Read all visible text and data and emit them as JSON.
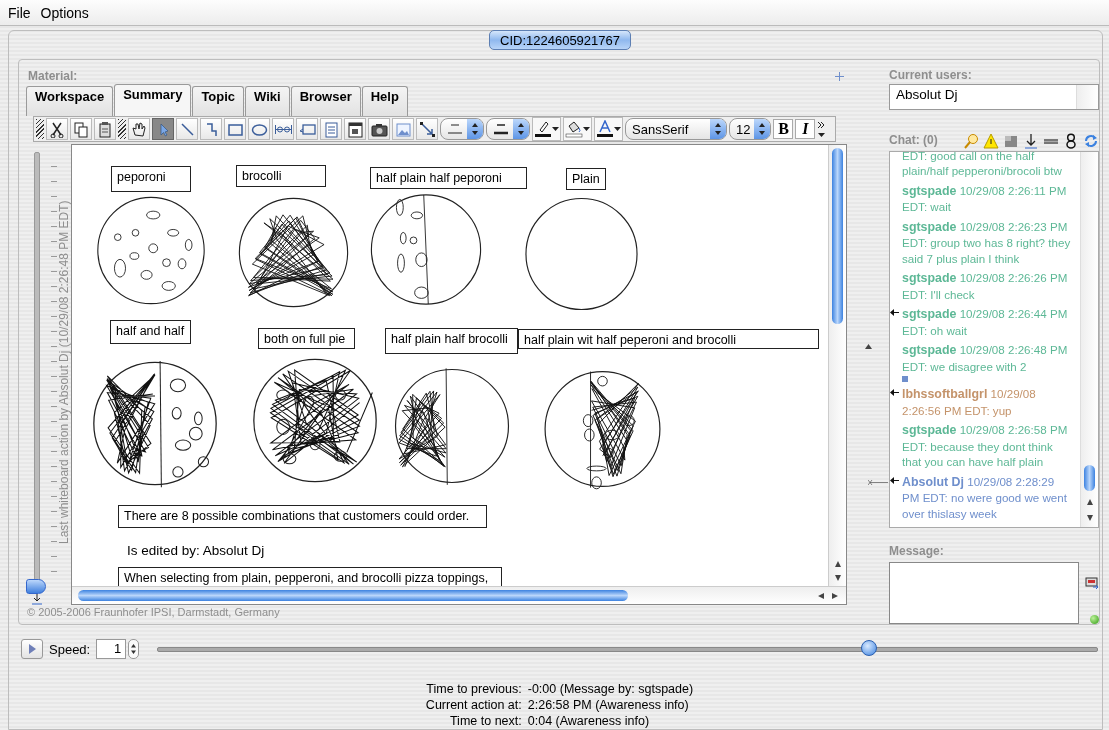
{
  "menu": [
    "File",
    "Options"
  ],
  "cid": "CID:1224605921767",
  "material_label": "Material:",
  "tabs": [
    {
      "label": "Workspace",
      "selected": false
    },
    {
      "label": "Summary",
      "selected": true
    },
    {
      "label": "Topic",
      "selected": false
    },
    {
      "label": "Wiki",
      "selected": false
    },
    {
      "label": "Browser",
      "selected": false
    },
    {
      "label": "Help",
      "selected": false
    }
  ],
  "toolbar": {
    "tools": [
      {
        "kind": "cut",
        "selected": false
      },
      {
        "kind": "copy",
        "selected": false
      },
      {
        "kind": "paste",
        "selected": false
      },
      {
        "kind": "hand",
        "selected": false
      },
      {
        "kind": "pointer",
        "selected": true
      },
      {
        "kind": "line",
        "selected": false
      },
      {
        "kind": "curve",
        "selected": false
      },
      {
        "kind": "rectangle",
        "selected": false
      },
      {
        "kind": "ellipse",
        "selected": false
      },
      {
        "kind": "link",
        "selected": false
      },
      {
        "kind": "comment",
        "selected": false
      },
      {
        "kind": "text",
        "selected": false
      },
      {
        "kind": "window",
        "selected": false
      },
      {
        "kind": "camera",
        "selected": false
      },
      {
        "kind": "image",
        "selected": false
      },
      {
        "kind": "resize",
        "selected": false
      }
    ],
    "font": "SansSerif",
    "font_size": "12",
    "bold": "B",
    "italic": "I"
  },
  "whiteboard": {
    "labels": [
      {
        "text": "peporoni",
        "boxed": true
      },
      {
        "text": "brocolli",
        "boxed": true
      },
      {
        "text": "half plain half peporoni",
        "boxed": true
      },
      {
        "text": "Plain",
        "boxed": true
      },
      {
        "text": "half and half",
        "boxed": true
      },
      {
        "text": "both on full pie",
        "boxed": true
      },
      {
        "text": "half plain half brocolli",
        "boxed": true
      },
      {
        "text": "half plain  wit half peperoni and brocolli",
        "boxed": true
      },
      {
        "text": "There are 8 possible combinations that customers could order.",
        "boxed": true
      },
      {
        "text": "Is edited by: Absolut Dj",
        "boxed": false
      },
      {
        "text": "When selecting from plain, pepperoni, and brocolli pizza toppings,",
        "boxed": true
      }
    ],
    "pizzas": [
      {
        "kind": "dots"
      },
      {
        "kind": "scribble"
      },
      {
        "kind": "half-dots"
      },
      {
        "kind": "plain"
      },
      {
        "kind": "half-scribble-dots"
      },
      {
        "kind": "scribble-dots"
      },
      {
        "kind": "half-scribble"
      },
      {
        "kind": "mixed"
      }
    ]
  },
  "history": {
    "caption": "Last whiteboard action by Absolut Dj (10/29/08 2:26:48 PM EDT)",
    "level": 0
  },
  "copyright": "© 2005-2006 Fraunhofer IPSI, Darmstadt, Germany",
  "current_users": {
    "label": "Current users:",
    "users": [
      "Absolut Dj"
    ]
  },
  "chat": {
    "label": "Chat: (0)",
    "messages": [
      {
        "text": "EDT: good call on the half plain/half pepperoni/brocoli btw",
        "color": "#5db896",
        "marked": false,
        "current": false,
        "flag": false
      },
      {
        "author": "sgtspade",
        "time": "10/29/08 2:26:11 PM",
        "text": "EDT: wait",
        "color": "#5db896",
        "marked": false,
        "current": false,
        "flag": false
      },
      {
        "author": "sgtspade",
        "time": "10/29/08 2:26:23 PM",
        "text": "EDT: group two has 8 right? they said 7 plus plain I think",
        "color": "#5db896",
        "marked": false,
        "current": false,
        "flag": false
      },
      {
        "author": "sgtspade",
        "time": "10/29/08 2:26:26 PM",
        "text": "EDT: I'll check",
        "color": "#5db896",
        "marked": false,
        "current": false,
        "flag": false
      },
      {
        "author": "sgtspade",
        "time": "10/29/08 2:26:44 PM",
        "text": "EDT: oh wait",
        "color": "#5db896",
        "marked": true,
        "current": false,
        "flag": false
      },
      {
        "author": "sgtspade",
        "time": "10/29/08 2:26:48 PM",
        "text": "EDT: we disagree with 2",
        "color": "#5db896",
        "marked": false,
        "current": false,
        "flag": true
      },
      {
        "author": "lbhssoftballgrl",
        "time": "10/29/08 2:26:56 PM",
        "text": "EDT: yup",
        "color": "#c4936a",
        "marked": true,
        "current": false,
        "flag": false
      },
      {
        "author": "sgtspade",
        "time": "10/29/08 2:26:58 PM",
        "text": "EDT: because they dont think that you can have half plain",
        "color": "#5db896",
        "marked": false,
        "current": false,
        "flag": false
      },
      {
        "author": "Absolut Dj",
        "time": "10/29/08 2:28:29 PM",
        "text": "EDT: no were good we went over thislasy week",
        "color": "#6f8fcc",
        "marked": true,
        "current": true,
        "flag": false
      }
    ]
  },
  "message": {
    "label": "Message:"
  },
  "playback": {
    "speed_label": "Speed:",
    "speed": "1",
    "level": 0.757
  },
  "timing": [
    {
      "label": "Time to previous:",
      "value": "-0:00 (Message by: sgtspade)"
    },
    {
      "label": "Current action at:",
      "value": "2:26:58 PM (Awareness info)"
    },
    {
      "label": "Time to next:",
      "value": "0:04 (Awareness info)"
    }
  ]
}
